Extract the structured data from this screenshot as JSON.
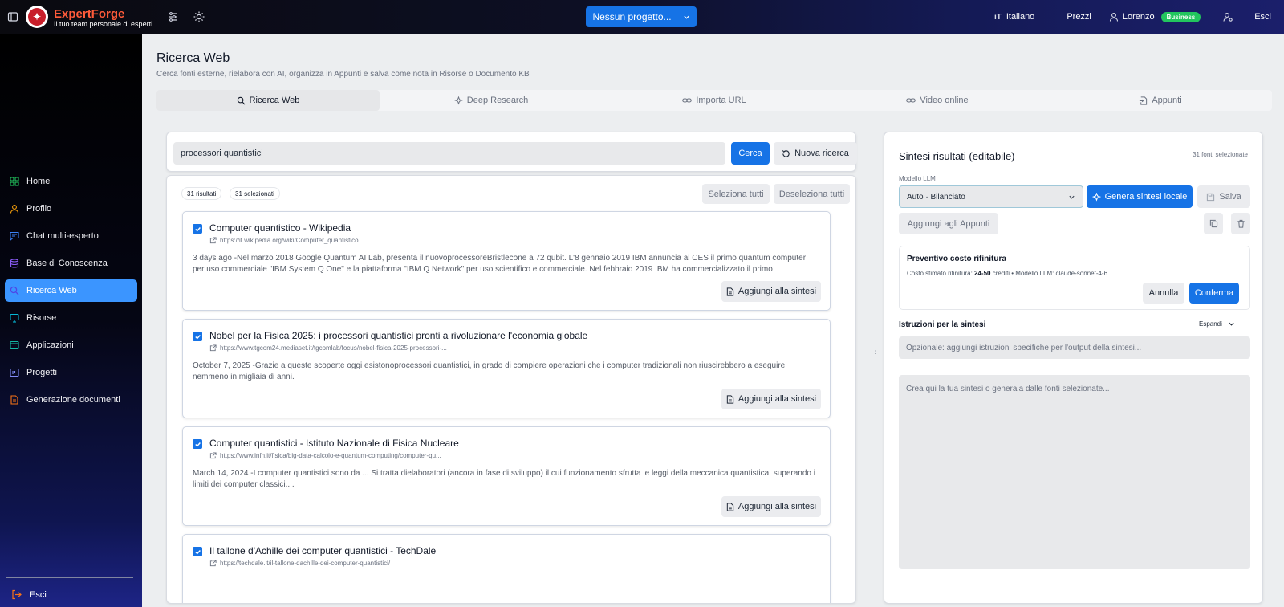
{
  "topbar": {
    "brand_name": "ExpertForge",
    "brand_tagline": "Il tuo team personale di esperti",
    "project_selector": "Nessun progetto...",
    "language": "Italiano",
    "pricing": "Prezzi",
    "user_name": "Lorenzo",
    "plan_badge": "Business",
    "logout": "Esci"
  },
  "sidebar": {
    "items": [
      {
        "label": "Home",
        "icon": "home-icon",
        "color": "#22c55e"
      },
      {
        "label": "Profilo",
        "icon": "user-icon",
        "color": "#f59e0b"
      },
      {
        "label": "Chat multi-esperto",
        "icon": "chat-icon",
        "color": "#3b82f6"
      },
      {
        "label": "Base di Conoscenza",
        "icon": "database-icon",
        "color": "#8b5cf6"
      },
      {
        "label": "Ricerca Web",
        "icon": "search-icon",
        "color": "#6366f1"
      },
      {
        "label": "Risorse",
        "icon": "monitor-icon",
        "color": "#06b6d4"
      },
      {
        "label": "Applicazioni",
        "icon": "app-window-icon",
        "color": "#14b8a6"
      },
      {
        "label": "Progetti",
        "icon": "projects-icon",
        "color": "#818cf8"
      },
      {
        "label": "Generazione documenti",
        "icon": "document-icon",
        "color": "#f97316"
      }
    ],
    "active_item": "Ricerca Web",
    "logout_label": "Esci"
  },
  "page": {
    "title": "Ricerca Web",
    "subtitle": "Cerca fonti esterne, rielabora con AI, organizza in Appunti e salva come nota in Risorse o Documento KB"
  },
  "tabs": [
    {
      "label": "Ricerca Web",
      "icon": "search-icon"
    },
    {
      "label": "Deep Research",
      "icon": "sparkles-icon"
    },
    {
      "label": "Importa URL",
      "icon": "link-icon"
    },
    {
      "label": "Video online",
      "icon": "link-icon"
    },
    {
      "label": "Appunti",
      "icon": "file-import-icon"
    }
  ],
  "search": {
    "query": "processori quantistici",
    "search_button": "Cerca",
    "new_search_button": "Nuova ricerca"
  },
  "results": {
    "count_label": "31 risultati",
    "selected_label": "31 selezionati",
    "select_all": "Seleziona tutti",
    "deselect_all": "Deseleziona tutti",
    "add_button": "Aggiungi alla sintesi",
    "items": [
      {
        "title": "Computer quantistico - Wikipedia",
        "url": "https://it.wikipedia.org/wiki/Computer_quantistico",
        "snippet": "3 days ago -Nel marzo 2018 Google Quantum AI Lab, presenta il nuovoprocessoreBristlecone a 72 qubit. L'8 gennaio 2019 IBM annuncia al CES il primo quantum computer per uso commerciale \"IBM System Q One\" e la piattaforma \"IBM Q Network\" per uso scientifico e commerciale. Nel febbraio 2019 IBM ha commercializzato il primo computerquantistico...",
        "checked": true
      },
      {
        "title": "Nobel per la Fisica 2025: i processori quantistici pronti a rivoluzionare l'economia globale",
        "url": "https://www.tgcom24.mediaset.it/tgcomlab/focus/nobel-fisica-2025-processori-...",
        "snippet": "October 7, 2025 -Grazie a queste scoperte oggi esistonoprocessori quantistici, in grado di compiere operazioni che i computer tradizionali non riuscirebbero a eseguire nemmeno in migliaia di anni.",
        "checked": true
      },
      {
        "title": "Computer quantistici - Istituto Nazionale di Fisica Nucleare",
        "url": "https://www.infn.it/fisica/big-data-calcolo-e-quantum-computing/computer-qu...",
        "snippet": "March 14, 2024 -I computer quantistici sono da ... Si tratta dielaboratori (ancora in fase di sviluppo) il cui funzionamento sfrutta le leggi della meccanica quantistica, superando i limiti dei computer classici....",
        "checked": true
      },
      {
        "title": "Il tallone d'Achille dei computer quantistici - TechDale",
        "url": "https://techdale.it/il-tallone-dachille-dei-computer-quantistici/",
        "snippet": "",
        "checked": true
      }
    ]
  },
  "synthesis": {
    "title": "Sintesi risultati (editabile)",
    "sources_selected": "31 fonti selezionate",
    "model_label": "Modello LLM",
    "model_value": "Auto · Bilanciato",
    "generate_button": "Genera sintesi locale",
    "save_button": "Salva",
    "add_to_notes": "Aggiungi agli Appunti",
    "cost": {
      "title": "Preventivo costo rifinitura",
      "line_prefix": "Costo stimato rifinitura: ",
      "line_value": "24-50",
      "line_suffix": " crediti • Modello LLM: claude-sonnet-4-6",
      "cancel": "Annulla",
      "confirm": "Conferma"
    },
    "instructions_label": "Istruzioni per la sintesi",
    "expand_label": "Espandi",
    "instructions_placeholder": "Opzionale: aggiungi istruzioni specifiche per l'output della sintesi...",
    "editor_placeholder": "Crea qui la tua sintesi o generala dalle fonti selezionate..."
  }
}
